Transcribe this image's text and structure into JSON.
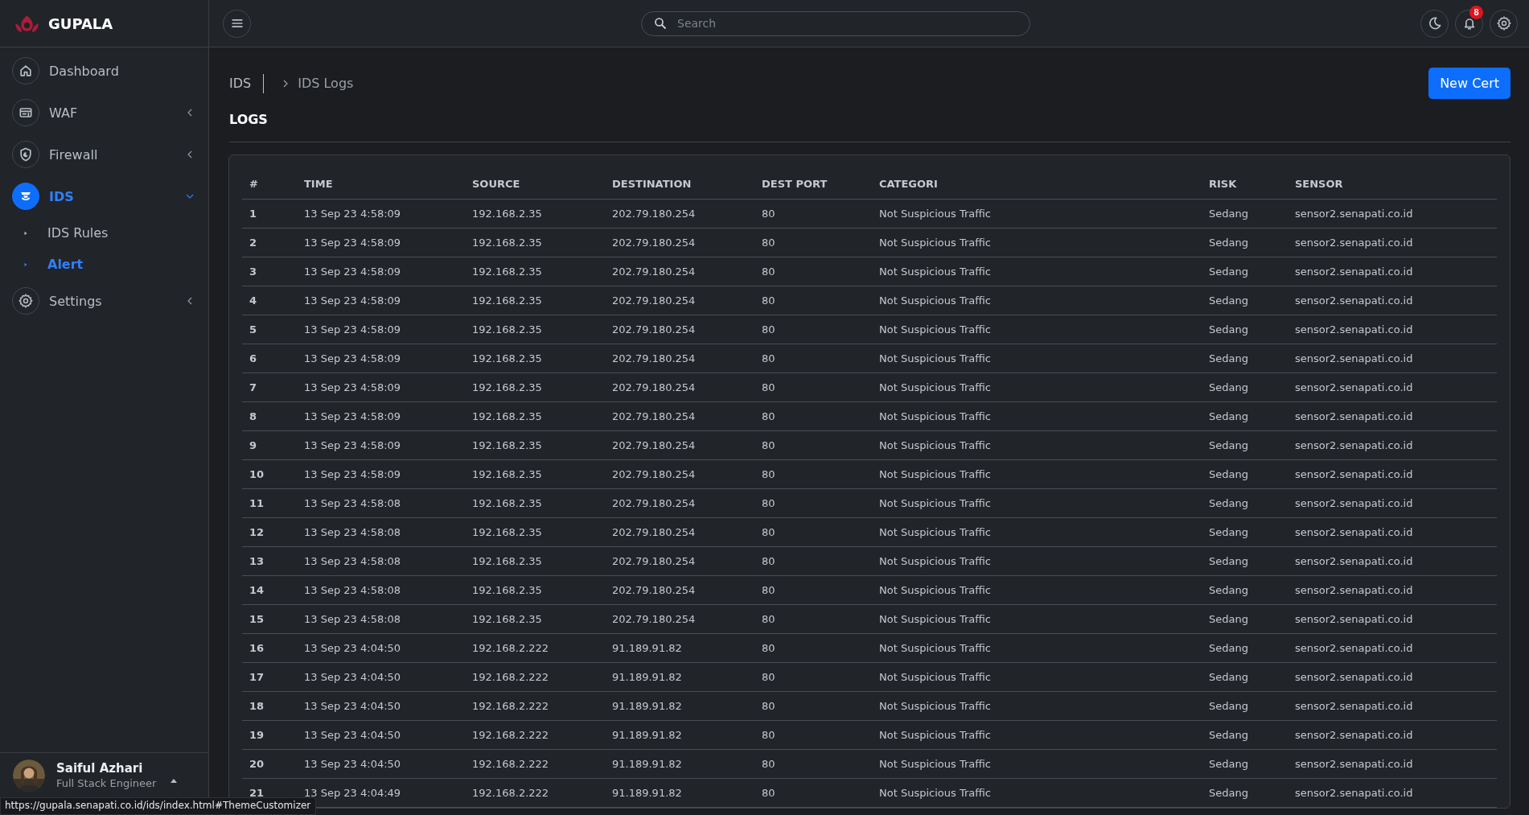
{
  "brand": {
    "name": "GUPALA"
  },
  "search": {
    "placeholder": "Search"
  },
  "notifications": {
    "count": "8"
  },
  "sidebar": {
    "items": [
      {
        "label": "Dashboard",
        "selected": false
      },
      {
        "label": "WAF",
        "selected": false,
        "expanded": false
      },
      {
        "label": "Firewall",
        "selected": false,
        "expanded": false
      },
      {
        "label": "IDS",
        "selected": true,
        "expanded": true,
        "children": [
          {
            "label": "IDS Rules",
            "selected": false
          },
          {
            "label": "Alert",
            "selected": true
          }
        ]
      },
      {
        "label": "Settings",
        "selected": false,
        "expanded": false
      }
    ]
  },
  "user": {
    "name": "Saiful Azhari",
    "role": "Full Stack Engineer"
  },
  "breadcrumb": [
    "IDS",
    "IDS Logs"
  ],
  "page_title": "LOGS",
  "new_button": "New Cert",
  "table": {
    "columns": [
      "#",
      "TIME",
      "SOURCE",
      "DESTINATION",
      "DEST PORT",
      "CATEGORI",
      "RISK",
      "SENSOR"
    ],
    "rows": [
      [
        "1",
        "13 Sep 23 4:58:09",
        "192.168.2.35",
        "202.79.180.254",
        "80",
        "Not Suspicious Traffic",
        "Sedang",
        "sensor2.senapati.co.id"
      ],
      [
        "2",
        "13 Sep 23 4:58:09",
        "192.168.2.35",
        "202.79.180.254",
        "80",
        "Not Suspicious Traffic",
        "Sedang",
        "sensor2.senapati.co.id"
      ],
      [
        "3",
        "13 Sep 23 4:58:09",
        "192.168.2.35",
        "202.79.180.254",
        "80",
        "Not Suspicious Traffic",
        "Sedang",
        "sensor2.senapati.co.id"
      ],
      [
        "4",
        "13 Sep 23 4:58:09",
        "192.168.2.35",
        "202.79.180.254",
        "80",
        "Not Suspicious Traffic",
        "Sedang",
        "sensor2.senapati.co.id"
      ],
      [
        "5",
        "13 Sep 23 4:58:09",
        "192.168.2.35",
        "202.79.180.254",
        "80",
        "Not Suspicious Traffic",
        "Sedang",
        "sensor2.senapati.co.id"
      ],
      [
        "6",
        "13 Sep 23 4:58:09",
        "192.168.2.35",
        "202.79.180.254",
        "80",
        "Not Suspicious Traffic",
        "Sedang",
        "sensor2.senapati.co.id"
      ],
      [
        "7",
        "13 Sep 23 4:58:09",
        "192.168.2.35",
        "202.79.180.254",
        "80",
        "Not Suspicious Traffic",
        "Sedang",
        "sensor2.senapati.co.id"
      ],
      [
        "8",
        "13 Sep 23 4:58:09",
        "192.168.2.35",
        "202.79.180.254",
        "80",
        "Not Suspicious Traffic",
        "Sedang",
        "sensor2.senapati.co.id"
      ],
      [
        "9",
        "13 Sep 23 4:58:09",
        "192.168.2.35",
        "202.79.180.254",
        "80",
        "Not Suspicious Traffic",
        "Sedang",
        "sensor2.senapati.co.id"
      ],
      [
        "10",
        "13 Sep 23 4:58:09",
        "192.168.2.35",
        "202.79.180.254",
        "80",
        "Not Suspicious Traffic",
        "Sedang",
        "sensor2.senapati.co.id"
      ],
      [
        "11",
        "13 Sep 23 4:58:08",
        "192.168.2.35",
        "202.79.180.254",
        "80",
        "Not Suspicious Traffic",
        "Sedang",
        "sensor2.senapati.co.id"
      ],
      [
        "12",
        "13 Sep 23 4:58:08",
        "192.168.2.35",
        "202.79.180.254",
        "80",
        "Not Suspicious Traffic",
        "Sedang",
        "sensor2.senapati.co.id"
      ],
      [
        "13",
        "13 Sep 23 4:58:08",
        "192.168.2.35",
        "202.79.180.254",
        "80",
        "Not Suspicious Traffic",
        "Sedang",
        "sensor2.senapati.co.id"
      ],
      [
        "14",
        "13 Sep 23 4:58:08",
        "192.168.2.35",
        "202.79.180.254",
        "80",
        "Not Suspicious Traffic",
        "Sedang",
        "sensor2.senapati.co.id"
      ],
      [
        "15",
        "13 Sep 23 4:58:08",
        "192.168.2.35",
        "202.79.180.254",
        "80",
        "Not Suspicious Traffic",
        "Sedang",
        "sensor2.senapati.co.id"
      ],
      [
        "16",
        "13 Sep 23 4:04:50",
        "192.168.2.222",
        "91.189.91.82",
        "80",
        "Not Suspicious Traffic",
        "Sedang",
        "sensor2.senapati.co.id"
      ],
      [
        "17",
        "13 Sep 23 4:04:50",
        "192.168.2.222",
        "91.189.91.82",
        "80",
        "Not Suspicious Traffic",
        "Sedang",
        "sensor2.senapati.co.id"
      ],
      [
        "18",
        "13 Sep 23 4:04:50",
        "192.168.2.222",
        "91.189.91.82",
        "80",
        "Not Suspicious Traffic",
        "Sedang",
        "sensor2.senapati.co.id"
      ],
      [
        "19",
        "13 Sep 23 4:04:50",
        "192.168.2.222",
        "91.189.91.82",
        "80",
        "Not Suspicious Traffic",
        "Sedang",
        "sensor2.senapati.co.id"
      ],
      [
        "20",
        "13 Sep 23 4:04:50",
        "192.168.2.222",
        "91.189.91.82",
        "80",
        "Not Suspicious Traffic",
        "Sedang",
        "sensor2.senapati.co.id"
      ],
      [
        "21",
        "13 Sep 23 4:04:49",
        "192.168.2.222",
        "91.189.91.82",
        "80",
        "Not Suspicious Traffic",
        "Sedang",
        "sensor2.senapati.co.id"
      ]
    ]
  },
  "status_url": "https://gupala.senapati.co.id/ids/index.html#ThemeCustomizer"
}
